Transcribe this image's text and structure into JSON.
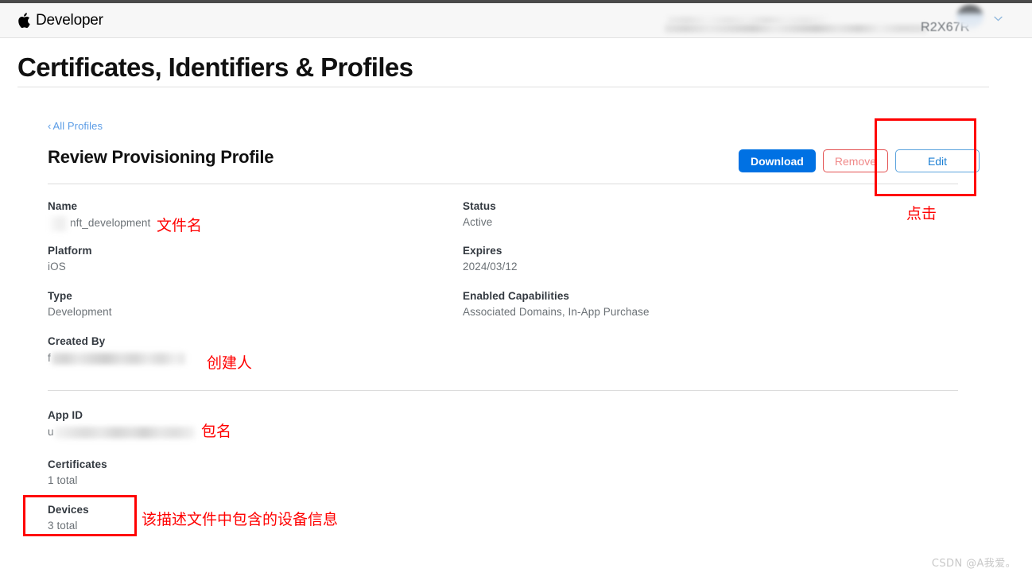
{
  "header": {
    "brand_name": "Developer",
    "apple_logo_icon": "apple-logo-icon",
    "account_team_id": "R2X67R",
    "avatar_icon": "avatar",
    "chevron_icon": "chevron-down-icon"
  },
  "page": {
    "title": "Certificates, Identifiers & Profiles",
    "breadcrumb_chevron": "‹",
    "breadcrumb_label": "All Profiles",
    "section_title": "Review Provisioning Profile"
  },
  "actions": {
    "download_label": "Download",
    "remove_label": "Remove",
    "edit_label": "Edit",
    "download_color": "#0071e3",
    "remove_color": "#e35050",
    "edit_color": "#1b7fd4"
  },
  "details": {
    "left": [
      {
        "label": "Name",
        "value": "nft_development",
        "redacted": true
      },
      {
        "label": "Platform",
        "value": "iOS",
        "redacted": false
      },
      {
        "label": "Type",
        "value": "Development",
        "redacted": false
      },
      {
        "label": "Created By",
        "value": "f",
        "redacted": true
      }
    ],
    "right": [
      {
        "label": "Status",
        "value": "Active"
      },
      {
        "label": "Expires",
        "value": "2024/03/12"
      },
      {
        "label": "Enabled Capabilities",
        "value": "Associated Domains, In-App Purchase"
      }
    ],
    "bottom": [
      {
        "label": "App ID",
        "value": "u",
        "redacted": true
      },
      {
        "label": "Certificates",
        "value": "1 total",
        "redacted": false
      },
      {
        "label": "Devices",
        "value": "3 total",
        "redacted": false
      }
    ]
  },
  "annotations": {
    "color": "#ff0000",
    "filename": "文件名",
    "creator": "创建人",
    "package": "包名",
    "devices": "该描述文件中包含的设备信息",
    "click": "点击"
  },
  "watermark": "CSDN @A我爱。"
}
